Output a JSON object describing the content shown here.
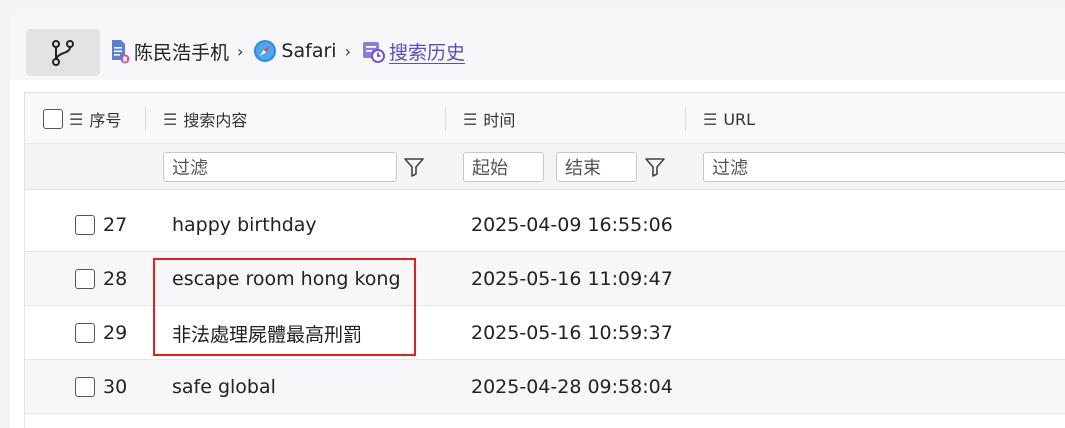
{
  "breadcrumb": {
    "device": "陈民浩手机",
    "app": "Safari",
    "page": "搜索历史"
  },
  "table": {
    "columns": {
      "index": "序号",
      "search": "搜索内容",
      "time": "时间",
      "url": "URL"
    },
    "filters": {
      "search_placeholder": "过滤",
      "start_placeholder": "起始",
      "end_placeholder": "结束",
      "url_placeholder": "过滤"
    },
    "rows": [
      {
        "index": "27",
        "search": "happy birthday",
        "time": "2025-04-09 16:55:06",
        "url": ""
      },
      {
        "index": "28",
        "search": "escape room hong kong",
        "time": "2025-05-16 11:09:47",
        "url": ""
      },
      {
        "index": "29",
        "search": "非法處理屍體最高刑罰",
        "time": "2025-05-16 10:59:37",
        "url": ""
      },
      {
        "index": "30",
        "search": "safe global",
        "time": "2025-04-28 09:58:04",
        "url": ""
      }
    ]
  },
  "colors": {
    "highlight_border": "#e02020",
    "active_crumb": "#5b4cc4"
  },
  "icons": {
    "branch": "branch-icon",
    "device": "phone-doc-icon",
    "app": "safari-compass-icon",
    "page": "history-icon",
    "column_menu": "list-icon",
    "filter": "funnel-icon"
  }
}
